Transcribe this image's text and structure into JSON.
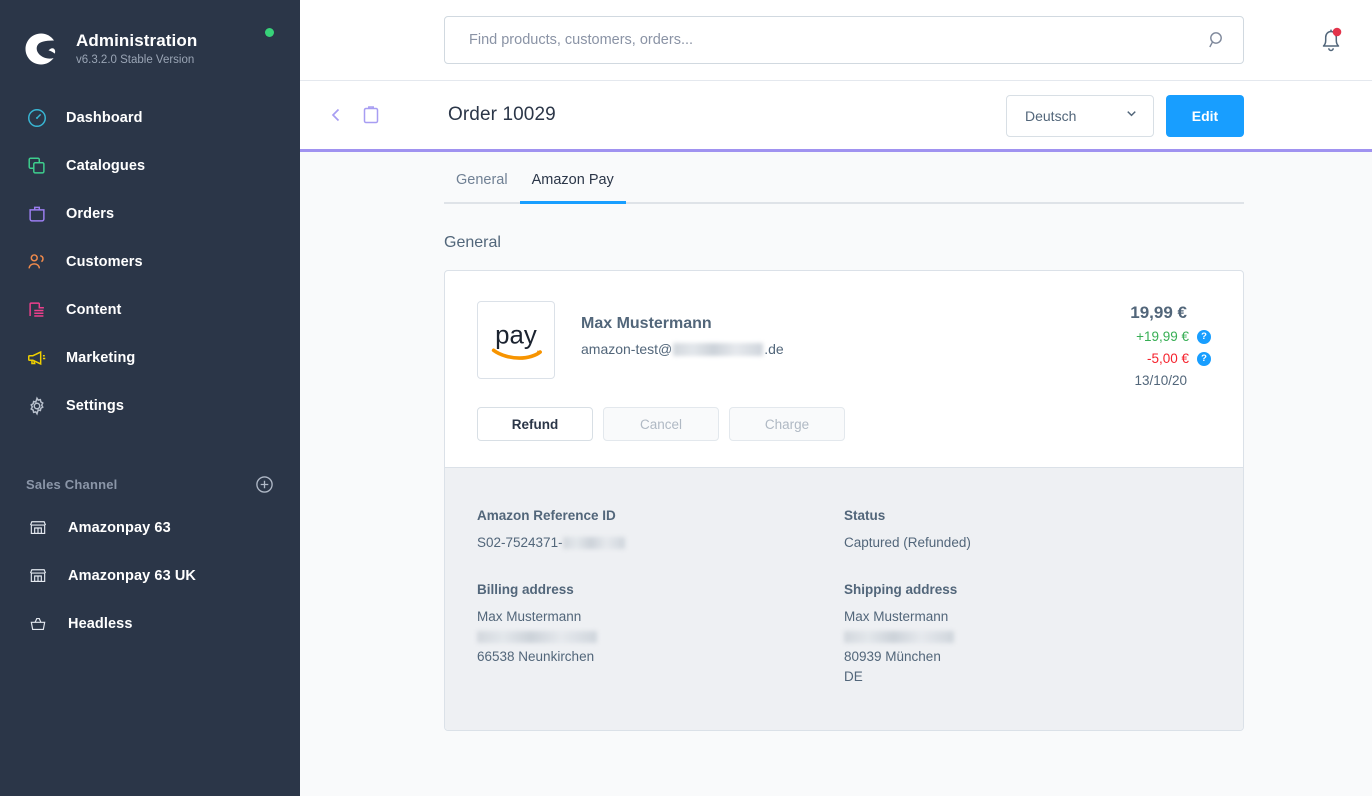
{
  "sidebar": {
    "brand": {
      "title": "Administration",
      "version": "v6.3.2.0 Stable Version",
      "status_color": "#37d279"
    },
    "nav": [
      {
        "label": "Dashboard",
        "icon": "gauge-icon",
        "color": "#38b6d4"
      },
      {
        "label": "Catalogues",
        "icon": "copy-icon",
        "color": "#3ecf8e"
      },
      {
        "label": "Orders",
        "icon": "bag-icon",
        "color": "#9b7ef0"
      },
      {
        "label": "Customers",
        "icon": "users-icon",
        "color": "#f08a4b"
      },
      {
        "label": "Content",
        "icon": "content-icon",
        "color": "#ee3f8c"
      },
      {
        "label": "Marketing",
        "icon": "megaphone-icon",
        "color": "#f0d000"
      },
      {
        "label": "Settings",
        "icon": "gear-icon",
        "color": "#b8c0cc"
      }
    ],
    "sales_channel": {
      "title": "Sales Channel",
      "add_icon": "plus-circle-icon",
      "items": [
        {
          "label": "Amazonpay 63",
          "icon": "storefront-icon"
        },
        {
          "label": "Amazonpay 63 UK",
          "icon": "storefront-icon"
        },
        {
          "label": "Headless",
          "icon": "basket-icon"
        }
      ]
    }
  },
  "topbar": {
    "search_placeholder": "Find products, customers, orders...",
    "search_value": "",
    "search_icon": "search-icon",
    "notification_icon": "bell-icon",
    "notification_badge_color": "#e3344b"
  },
  "order_header": {
    "back_icon": "chevron-left-icon",
    "folder_icon": "clipboard-icon",
    "title": "Order 10029",
    "language": "Deutsch",
    "language_chevron_icon": "chevron-down-icon",
    "edit_label": "Edit",
    "edit_color": "#189eff",
    "accent_rule_color": "#a092f0"
  },
  "tabs": [
    {
      "label": "General",
      "active": false
    },
    {
      "label": "Amazon Pay",
      "active": true
    }
  ],
  "main": {
    "section_label": "General",
    "payment": {
      "logo": "amazon-pay-logo",
      "customer_name": "Max Mustermann",
      "email_prefix": "amazon-test@",
      "email_suffix": ".de",
      "total": "19,99 €",
      "captured": "+19,99 €",
      "captured_color": "#37ae54",
      "refunded": "-5,00 €",
      "refunded_color": "#f5222d",
      "date": "13/10/20",
      "help_icon": "help-circle-icon",
      "buttons": [
        {
          "label": "Refund",
          "disabled": false
        },
        {
          "label": "Cancel",
          "disabled": true
        },
        {
          "label": "Charge",
          "disabled": true
        }
      ]
    },
    "details": {
      "reference_title": "Amazon Reference ID",
      "reference_value": "S02-7524371-",
      "status_title": "Status",
      "status_value": "Captured (Refunded)",
      "billing_title": "Billing address",
      "billing_name": "Max Mustermann",
      "billing_city": "66538 Neunkirchen",
      "shipping_title": "Shipping address",
      "shipping_name": "Max Mustermann",
      "shipping_city": "80939 München",
      "shipping_country": "DE"
    }
  }
}
